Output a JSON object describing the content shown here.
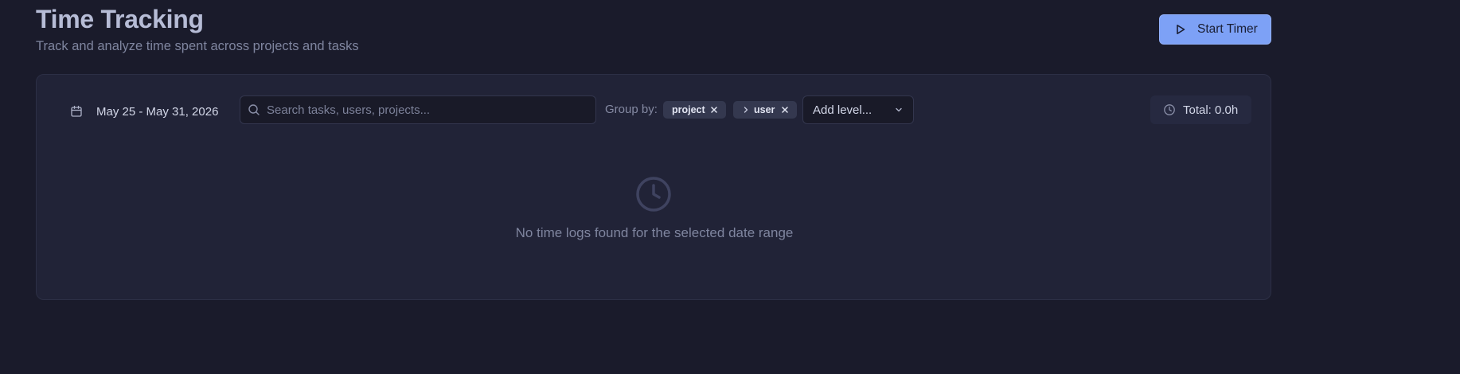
{
  "header": {
    "title": "Time Tracking",
    "subtitle": "Track and analyze time spent across projects and tasks",
    "start_timer_label": "Start Timer"
  },
  "toolbar": {
    "date_range": "May 25 - May 31, 2026",
    "search_placeholder": "Search tasks, users, projects...",
    "search_value": "",
    "group_by_label": "Group by:",
    "group_levels": [
      {
        "label": "project"
      },
      {
        "label": "user"
      }
    ],
    "add_level_label": "Add level...",
    "total_label": "Total: 0.0h"
  },
  "empty_state": {
    "message": "No time logs found for the selected date range"
  },
  "icons": {
    "start_timer": "play-icon",
    "date_range": "calendar-icon",
    "search": "search-icon",
    "chip_remove": "close-icon",
    "chip_nested": "chevron-right-icon",
    "add_level": "chevron-down-icon",
    "total": "clock-icon",
    "empty_state": "clock-icon"
  },
  "colors": {
    "background": "#1a1b2b",
    "card": "#212337",
    "accent": "#7da1f6",
    "chip": "#34384f"
  }
}
